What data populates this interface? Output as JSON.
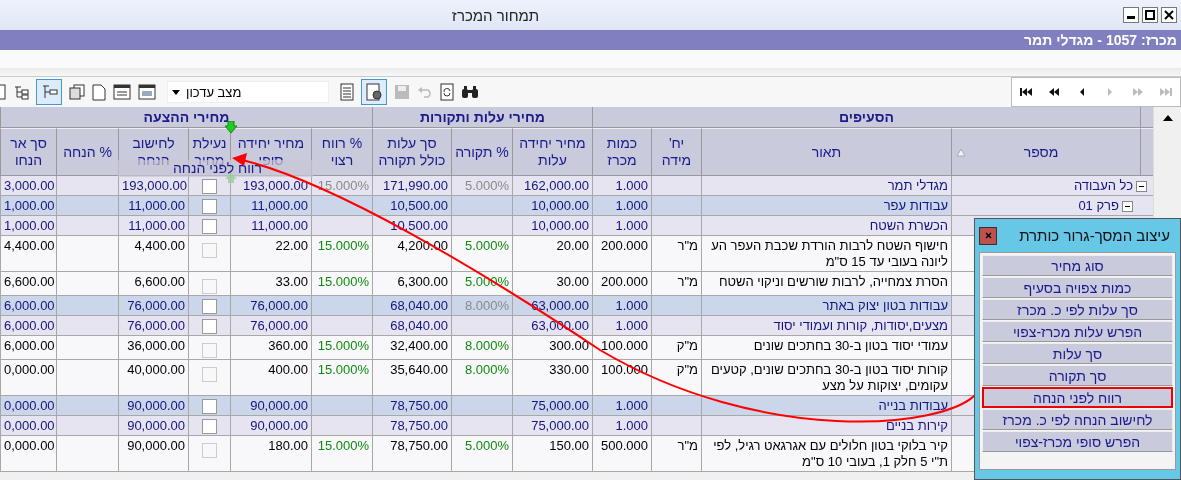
{
  "window": {
    "title": "תמחור המכרז"
  },
  "tender_bar": {
    "text": "מכרז: 1057 - מגדלי תמר"
  },
  "toolbar": {
    "mode_dropdown": {
      "value": "מצב עדכון"
    }
  },
  "table": {
    "groups": [
      {
        "label": "הסעיפים",
        "columns": [
          {
            "label": "מספר",
            "kind": "tree"
          },
          {
            "label": "תאור",
            "kind": "text"
          },
          {
            "label": "יח' מידה",
            "kind": "text"
          },
          {
            "label": "כמות מכרז",
            "kind": "number"
          }
        ]
      },
      {
        "label": "מחירי עלות ותקורות",
        "columns": [
          {
            "label": "מחיר יחידה עלות",
            "kind": "number"
          },
          {
            "label": "% תקורה",
            "kind": "percent"
          },
          {
            "label": "סך עלות כולל תקורה",
            "kind": "number"
          }
        ]
      },
      {
        "label": "מחירי ההצעה",
        "columns": [
          {
            "label": "% רווח רצוי",
            "kind": "percent"
          },
          {
            "label": "מחיר יחידה סופי",
            "kind": "number"
          },
          {
            "label": "נעילת מחיר",
            "kind": "check"
          },
          {
            "label": "לחישוב הנחה",
            "kind": "number"
          },
          {
            "label": "% הנחה",
            "kind": "percent"
          },
          {
            "label": "סך אר הנחו",
            "kind": "number"
          }
        ]
      }
    ],
    "rows": [
      {
        "kind": "total",
        "expanded": true,
        "price_locked": false,
        "cells": [
          "כל העבודה",
          "מגדלי תמר",
          null,
          "1.000",
          "162,000.00",
          "5.000%",
          "171,990.00",
          "15.000%",
          "193,000.00",
          "193,000.00",
          null,
          "3,000.00"
        ]
      },
      {
        "kind": "chapter",
        "expanded": true,
        "price_locked": false,
        "cells": [
          "פרק 01",
          "עבודות עפר",
          null,
          "1.000",
          "10,000.00",
          null,
          "10,500.00",
          null,
          "11,000.00",
          "11,000.00",
          null,
          "1,000.00"
        ]
      },
      {
        "kind": "section",
        "price_locked": false,
        "cells": [
          null,
          "הכשרת השטח",
          null,
          "1.000",
          "10,000.00",
          null,
          "10,500.00",
          null,
          "11,000.00",
          "11,000.00",
          null,
          "1,000.00"
        ]
      },
      {
        "kind": "item",
        "price_locked": false,
        "cells": [
          null,
          "חישוף השטח לרבות הורדת שכבת העפר העליונה בעובי עד 15 ס\"מ",
          "מ\"ר",
          "200.000",
          "20.00",
          "5.000%",
          "4,200.00",
          "15.000%",
          "22.00",
          "4,400.00",
          null,
          "4,400.00"
        ]
      },
      {
        "kind": "item",
        "price_locked": false,
        "cells": [
          null,
          "הסרת צמחייה, לרבות שורשים וניקוי השטח",
          "מ\"ר",
          "200.000",
          "30.00",
          "5.000%",
          "6,300.00",
          "15.000%",
          "33.00",
          "6,600.00",
          null,
          "6,600.00"
        ]
      },
      {
        "kind": "chapter",
        "price_locked": false,
        "cells": [
          null,
          "עבודות בטון יצוק באתר",
          null,
          "1.000",
          "63,000.00",
          "8.000%",
          "68,040.00",
          null,
          "76,000.00",
          "76,000.00",
          null,
          "6,000.00"
        ]
      },
      {
        "kind": "section",
        "price_locked": false,
        "cells": [
          null,
          "מצעים,יסודות, קורות ועמודי יסוד",
          null,
          "1.000",
          "63,000.00",
          null,
          "68,040.00",
          null,
          "76,000.00",
          "76,000.00",
          null,
          "6,000.00"
        ]
      },
      {
        "kind": "item",
        "price_locked": false,
        "cells": [
          null,
          "עמודי יסוד בטון ב-30 בחתכים שונים",
          "מ\"ק",
          "100.000",
          "300.00",
          "8.000%",
          "32,400.00",
          "15.000%",
          "360.00",
          "36,000.00",
          null,
          "6,000.00"
        ]
      },
      {
        "kind": "item",
        "price_locked": false,
        "cells": [
          null,
          "קורות יסוד בטון ב-30 בחתכים שונים, קטעים עקומים, יצוקות על מצע",
          "מ\"ק",
          "100.000",
          "330.00",
          "8.000%",
          "35,640.00",
          "15.000%",
          "400.00",
          "40,000.00",
          null,
          "0,000.00"
        ]
      },
      {
        "kind": "chapter",
        "price_locked": false,
        "cells": [
          null,
          "עבודות בנייה",
          null,
          "1.000",
          "75,000.00",
          null,
          "78,750.00",
          null,
          "90,000.00",
          "90,000.00",
          null,
          "0,000.00"
        ]
      },
      {
        "kind": "section",
        "price_locked": false,
        "cells": [
          null,
          "קירות בניים",
          null,
          "1.000",
          "75,000.00",
          null,
          "78,750.00",
          null,
          "90,000.00",
          "90,000.00",
          null,
          "0,000.00"
        ]
      },
      {
        "kind": "item",
        "price_locked": false,
        "cells": [
          null,
          "קיר בלוקי בטון חלולים עם אגרגאט רגיל, לפי ת\"י 5 חלק 1, בעובי 10 ס\"מ",
          "מ\"ר",
          "500.000",
          "150.00",
          "5.000%",
          "78,750.00",
          "15.000%",
          "180.00",
          "90,000.00",
          null,
          "0,000.00"
        ]
      }
    ]
  },
  "drag_label": {
    "text": "רווח לפני הנחה"
  },
  "panel": {
    "title": "עיצוב המסך-גרור כותרת",
    "items": [
      {
        "label": "סוג מחיר",
        "selected": false
      },
      {
        "label": "כמות צפויה בסעיף",
        "selected": false
      },
      {
        "label": "סך עלות לפי כ. מכרז",
        "selected": false
      },
      {
        "label": "הפרש עלות מכרז-צפוי",
        "selected": false
      },
      {
        "label": "סך עלות",
        "selected": false
      },
      {
        "label": "סך תקורה",
        "selected": false
      },
      {
        "label": "רווח  לפני הנחה",
        "selected": true
      },
      {
        "label": "לחישוב הנחה לפי כ. מכרז",
        "selected": false
      },
      {
        "label": "הפרש סופי מכרז-צפוי",
        "selected": false
      }
    ]
  }
}
